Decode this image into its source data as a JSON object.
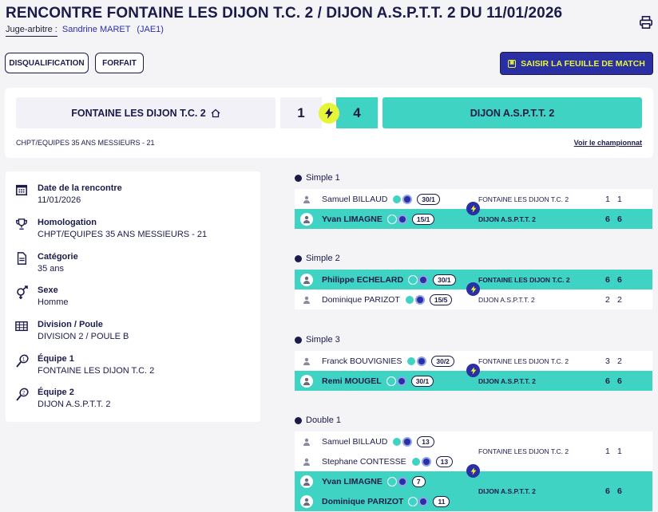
{
  "header": {
    "title": "RENCONTRE FONTAINE LES DIJON T.C. 2 / DIJON A.S.P.T.T. 2 DU 11/01/2026",
    "referee_label": "Juge-arbitre :",
    "referee_name": "Sandrine MARET",
    "referee_code": "(JAE1)",
    "print_icon": "printer-icon"
  },
  "actions": {
    "disqualification": "DISQUALIFICATION",
    "forfait": "FORFAIT",
    "enter_sheet": "SAISIR LA FEUILLE DE MATCH"
  },
  "scoreboard": {
    "home_team": "FONTAINE LES DIJON T.C. 2",
    "home_score": "1",
    "away_score": "4",
    "away_team": "DIJON A.S.P.T.T. 2",
    "championship": "CHPT/EQUIPES 35 ANS MESSIEURS - 21",
    "championship_link": "Voir le championnat"
  },
  "details": [
    {
      "icon": "calendar-icon",
      "label": "Date de la rencontre",
      "value": "11/01/2026"
    },
    {
      "icon": "trophy-icon",
      "label": "Homologation",
      "value": "CHPT/EQUIPES 35 ANS MESSIEURS - 21"
    },
    {
      "icon": "document-icon",
      "label": "Catégorie",
      "value": "35 ans"
    },
    {
      "icon": "gender-icon",
      "label": "Sexe",
      "value": "Homme"
    },
    {
      "icon": "grid-icon",
      "label": "Division / Poule",
      "value": "DIVISION 2 / POULE B"
    },
    {
      "icon": "racket-1-icon",
      "label": "Équipe 1",
      "value": "FONTAINE LES DIJON T.C. 2"
    },
    {
      "icon": "racket-2-icon",
      "label": "Équipe 2",
      "value": "DIJON A.S.P.T.T. 2"
    }
  ],
  "matches": [
    {
      "title": "Simple 1",
      "home_team": "FONTAINE LES DIJON T.C. 2",
      "away_team": "DIJON A.S.P.T.T. 2",
      "home_players": [
        {
          "name": "Samuel BILLAUD",
          "rank": "30/1"
        }
      ],
      "away_players": [
        {
          "name": "Yvan LIMAGNE",
          "rank": "15/1"
        }
      ],
      "home_sets": [
        "1",
        "1"
      ],
      "away_sets": [
        "6",
        "6"
      ],
      "winner": "away"
    },
    {
      "title": "Simple 2",
      "home_team": "FONTAINE LES DIJON T.C. 2",
      "away_team": "DIJON A.S.P.T.T. 2",
      "home_players": [
        {
          "name": "Philippe ECHELARD",
          "rank": "30/1"
        }
      ],
      "away_players": [
        {
          "name": "Dominique PARIZOT",
          "rank": "15/5"
        }
      ],
      "home_sets": [
        "6",
        "6"
      ],
      "away_sets": [
        "2",
        "2"
      ],
      "winner": "home"
    },
    {
      "title": "Simple 3",
      "home_team": "FONTAINE LES DIJON T.C. 2",
      "away_team": "DIJON A.S.P.T.T. 2",
      "home_players": [
        {
          "name": "Franck BOUVIGNIES",
          "rank": "30/2"
        }
      ],
      "away_players": [
        {
          "name": "Remi MOUGEL",
          "rank": "30/1"
        }
      ],
      "home_sets": [
        "3",
        "2"
      ],
      "away_sets": [
        "6",
        "6"
      ],
      "winner": "away"
    },
    {
      "title": "Double 1",
      "home_team": "FONTAINE LES DIJON T.C. 2",
      "away_team": "DIJON A.S.P.T.T. 2",
      "home_players": [
        {
          "name": "Samuel BILLAUD",
          "rank": "13"
        },
        {
          "name": "Stephane CONTESSE",
          "rank": "13"
        }
      ],
      "away_players": [
        {
          "name": "Yvan LIMAGNE",
          "rank": "7"
        },
        {
          "name": "Dominique PARIZOT",
          "rank": "11"
        }
      ],
      "home_sets": [
        "1",
        "1"
      ],
      "away_sets": [
        "6",
        "6"
      ],
      "winner": "away"
    }
  ]
}
